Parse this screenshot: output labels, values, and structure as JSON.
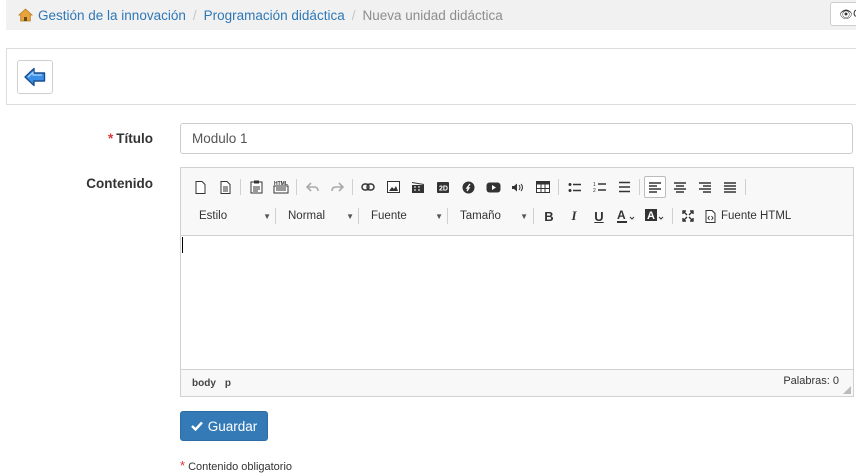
{
  "breadcrumb": {
    "items": [
      "Gestión de la innovación",
      "Programación didáctica"
    ],
    "active": "Nueva unidad didáctica",
    "separator": "/"
  },
  "header": {
    "view_button_label": "C"
  },
  "form": {
    "titulo_label": "Título",
    "titulo_value": "Modulo 1",
    "contenido_label": "Contenido",
    "required_marker": "*",
    "save_label": "Guardar",
    "required_note": "Contenido obligatorio"
  },
  "editor": {
    "combos": [
      "Estilo",
      "Normal",
      "Fuente",
      "Tamaño"
    ],
    "source_label": "Fuente HTML",
    "path": [
      "body",
      "p"
    ],
    "wordcount": "Palabras: 0"
  },
  "colors": {
    "link": "#2f78b6",
    "primary": "#337ab7",
    "required": "#dd3333"
  }
}
